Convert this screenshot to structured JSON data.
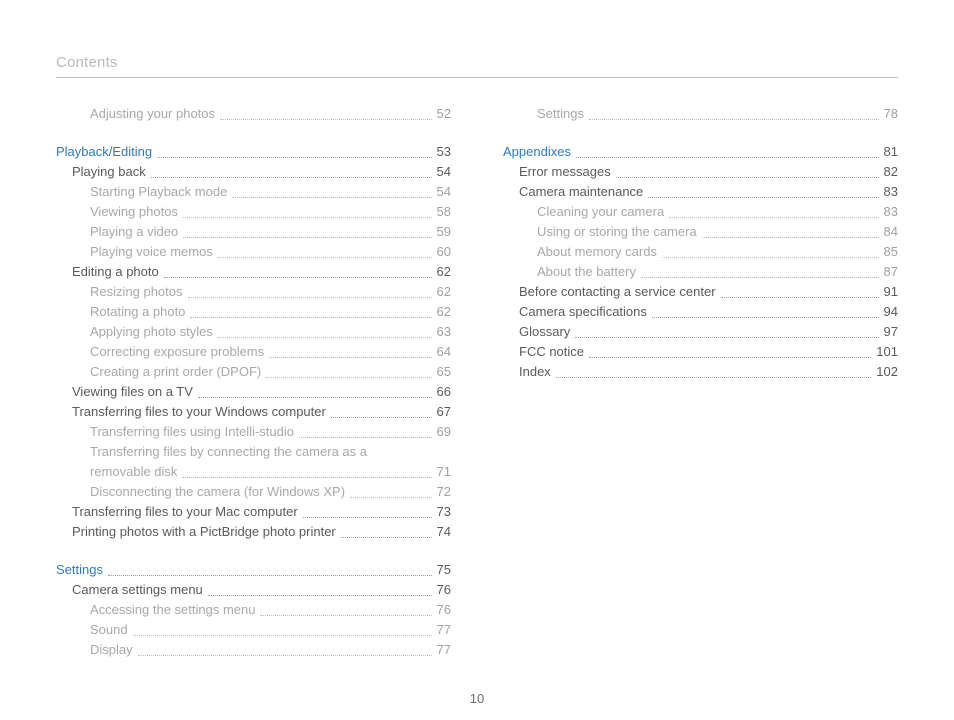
{
  "header": {
    "title": "Contents"
  },
  "footer": {
    "page_number": "10"
  },
  "columns": [
    {
      "entries": [
        {
          "level": 3,
          "label": "Adjusting your photos",
          "page": "52"
        },
        {
          "gap": true
        },
        {
          "level": 1,
          "label": "Playback/Editing",
          "page": "53"
        },
        {
          "level": 2,
          "label": "Playing back",
          "page": "54"
        },
        {
          "level": 3,
          "label": "Starting Playback mode",
          "page": "54"
        },
        {
          "level": 3,
          "label": "Viewing photos",
          "page": "58"
        },
        {
          "level": 3,
          "label": "Playing a video",
          "page": "59"
        },
        {
          "level": 3,
          "label": "Playing voice memos",
          "page": "60"
        },
        {
          "level": 2,
          "label": "Editing a photo",
          "page": "62"
        },
        {
          "level": 3,
          "label": "Resizing photos",
          "page": "62"
        },
        {
          "level": 3,
          "label": "Rotating a photo",
          "page": "62"
        },
        {
          "level": 3,
          "label": "Applying photo styles",
          "page": "63"
        },
        {
          "level": 3,
          "label": "Correcting exposure problems",
          "page": "64"
        },
        {
          "level": 3,
          "label": "Creating a print order (DPOF)",
          "page": "65"
        },
        {
          "level": 2,
          "label": "Viewing files on a TV",
          "page": "66"
        },
        {
          "level": 2,
          "label": "Transferring files to your Windows computer",
          "page": "67"
        },
        {
          "level": 3,
          "label": "Transferring files using Intelli-studio",
          "page": "69"
        },
        {
          "level": 3,
          "label_pre": "Transferring files by connecting the camera as a",
          "label": "removable disk",
          "page": "71"
        },
        {
          "level": 3,
          "label": "Disconnecting the camera (for Windows XP)",
          "page": "72"
        },
        {
          "level": 2,
          "label": "Transferring files to your Mac computer",
          "page": "73"
        },
        {
          "level": 2,
          "label": "Printing photos with a PictBridge photo printer",
          "page": "74"
        },
        {
          "gap": true
        },
        {
          "level": 1,
          "label": "Settings",
          "page": "75"
        },
        {
          "level": 2,
          "label": "Camera settings menu",
          "page": "76"
        },
        {
          "level": 3,
          "label": "Accessing the settings menu",
          "page": "76"
        },
        {
          "level": 3,
          "label": "Sound",
          "page": "77"
        },
        {
          "level": 3,
          "label": "Display",
          "page": "77"
        }
      ]
    },
    {
      "entries": [
        {
          "level": 3,
          "label": "Settings",
          "page": "78"
        },
        {
          "gap": true
        },
        {
          "level": 1,
          "label": "Appendixes",
          "page": "81"
        },
        {
          "level": 2,
          "label": "Error messages",
          "page": "82"
        },
        {
          "level": 2,
          "label": "Camera maintenance",
          "page": "83"
        },
        {
          "level": 3,
          "label": "Cleaning your camera",
          "page": "83"
        },
        {
          "level": 3,
          "label": "Using or storing the camera",
          "page": "84"
        },
        {
          "level": 3,
          "label": "About memory cards",
          "page": "85"
        },
        {
          "level": 3,
          "label": "About the battery",
          "page": "87"
        },
        {
          "level": 2,
          "label": "Before contacting a service center",
          "page": "91"
        },
        {
          "level": 2,
          "label": "Camera specifications",
          "page": "94"
        },
        {
          "level": 2,
          "label": "Glossary",
          "page": "97"
        },
        {
          "level": 2,
          "label": "FCC notice",
          "page": "101"
        },
        {
          "level": 2,
          "label": "Index",
          "page": "102"
        }
      ]
    }
  ]
}
